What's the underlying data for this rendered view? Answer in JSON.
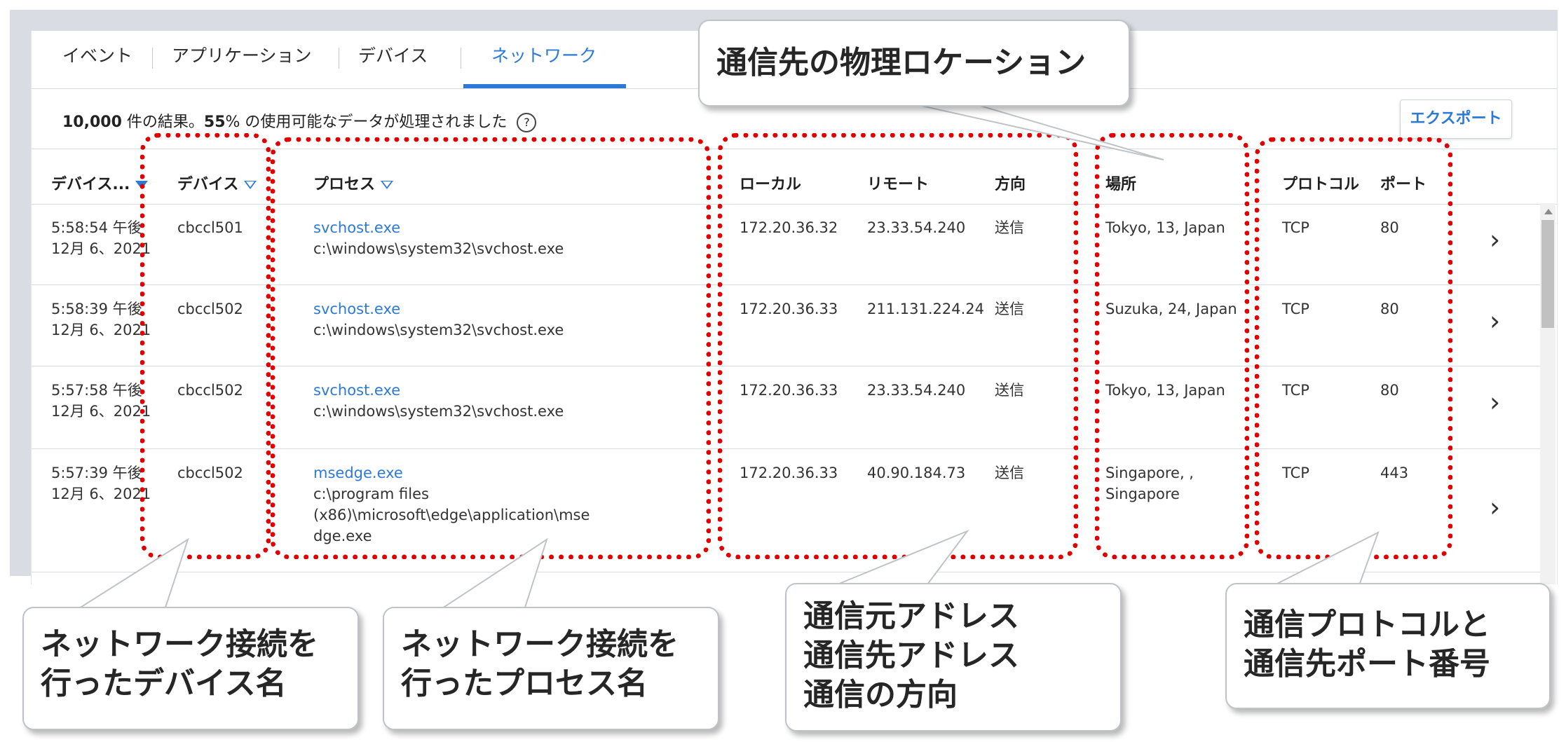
{
  "tabs": [
    {
      "label": "イベント",
      "active": false
    },
    {
      "label": "アプリケーション",
      "active": false
    },
    {
      "label": "デバイス",
      "active": false
    },
    {
      "label": "ネットワーク",
      "active": true
    }
  ],
  "summary": {
    "count": "10,000",
    "results_text": " 件の結果。",
    "percent": "55",
    "processed_text": "% の使用可能なデータが処理されました",
    "help_glyph": "?"
  },
  "export_label": "エクスポート",
  "columns": {
    "device_time": "デバイス...",
    "device": "デバイス",
    "process": "プロセス",
    "local": "ローカル",
    "remote": "リモート",
    "direction": "方向",
    "location": "場所",
    "protocol": "プロトコル",
    "port": "ポート"
  },
  "rows": [
    {
      "time": "5:58:54 午後",
      "date": "12月 6、2021",
      "device": "cbccl501",
      "process_name": "svchost.exe",
      "process_path": [
        "c:\\windows\\system32\\svchost.exe"
      ],
      "local": "172.20.36.32",
      "remote": "23.33.54.240",
      "direction": "送信",
      "location": [
        "Tokyo, 13, Japan"
      ],
      "protocol": "TCP",
      "port": "80"
    },
    {
      "time": "5:58:39 午後",
      "date": "12月 6、2021",
      "device": "cbccl502",
      "process_name": "svchost.exe",
      "process_path": [
        "c:\\windows\\system32\\svchost.exe"
      ],
      "local": "172.20.36.33",
      "remote": "211.131.224.24",
      "direction": "送信",
      "location": [
        "Suzuka, 24, Japan"
      ],
      "protocol": "TCP",
      "port": "80"
    },
    {
      "time": "5:57:58 午後",
      "date": "12月 6、2021",
      "device": "cbccl502",
      "process_name": "svchost.exe",
      "process_path": [
        "c:\\windows\\system32\\svchost.exe"
      ],
      "local": "172.20.36.33",
      "remote": "23.33.54.240",
      "direction": "送信",
      "location": [
        "Tokyo, 13, Japan"
      ],
      "protocol": "TCP",
      "port": "80"
    },
    {
      "time": "5:57:39 午後",
      "date": "12月 6、2021",
      "device": "cbccl502",
      "process_name": "msedge.exe",
      "process_path": [
        "c:\\program files",
        "(x86)\\microsoft\\edge\\application\\mse",
        "dge.exe"
      ],
      "local": "172.20.36.33",
      "remote": "40.90.184.73",
      "direction": "送信",
      "location": [
        "Singapore, ,",
        "Singapore"
      ],
      "protocol": "TCP",
      "port": "443"
    }
  ],
  "chevron_glyph": "›",
  "callouts": {
    "location": [
      "通信先の物理ロケーション"
    ],
    "device": [
      "ネットワーク接続を",
      "行ったデバイス名"
    ],
    "process": [
      "ネットワーク接続を",
      "行ったプロセス名"
    ],
    "address": [
      "通信元アドレス",
      "通信先アドレス",
      "通信の方向"
    ],
    "protocol": [
      "通信プロトコルと",
      "通信先ポート番号"
    ]
  },
  "colors": {
    "accent": "#2c7ad8",
    "annotation": "#e00000"
  }
}
